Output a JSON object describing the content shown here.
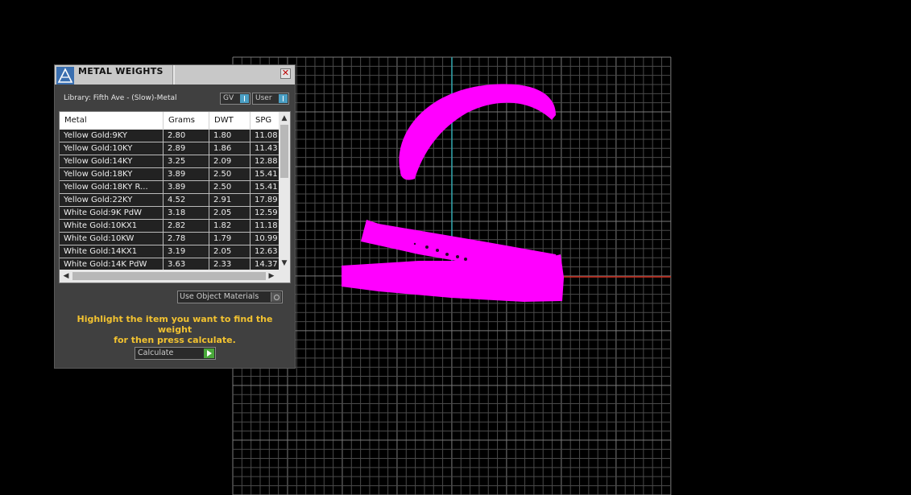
{
  "colors": {
    "grid": "#5c5c5c",
    "axis_x": "#cc2a1a",
    "axis_y": "#2fa6ad",
    "model": "#ff00ff",
    "accent": "#f2c230"
  },
  "panel": {
    "title": "METAL WEIGHTS",
    "close_symbol": "✕",
    "library_label": "Library: Fifth Ave - (Slow)-Metal",
    "toggle_gv": "GV",
    "toggle_user": "User",
    "table": {
      "columns": [
        "Metal",
        "Grams",
        "DWT",
        "SPG"
      ],
      "rows": [
        [
          "Yellow Gold:9KY",
          "2.80",
          "1.80",
          "11.08"
        ],
        [
          "Yellow Gold:10KY",
          "2.89",
          "1.86",
          "11.43"
        ],
        [
          "Yellow Gold:14KY",
          "3.25",
          "2.09",
          "12.88"
        ],
        [
          "Yellow Gold:18KY",
          "3.89",
          "2.50",
          "15.41"
        ],
        [
          "Yellow Gold:18KY R...",
          "3.89",
          "2.50",
          "15.41"
        ],
        [
          "Yellow Gold:22KY",
          "4.52",
          "2.91",
          "17.89"
        ],
        [
          "White Gold:9K PdW",
          "3.18",
          "2.05",
          "12.59"
        ],
        [
          "White Gold:10KX1",
          "2.82",
          "1.82",
          "11.18"
        ],
        [
          "White Gold:10KW",
          "2.78",
          "1.79",
          "10.99"
        ],
        [
          "White Gold:14KX1",
          "3.19",
          "2.05",
          "12.63"
        ],
        [
          "White Gold:14K PdW",
          "3.63",
          "2.33",
          "14.37"
        ]
      ]
    },
    "use_object_materials": "Use Object Materials",
    "hint_line1": "Highlight the item you want to find the weight",
    "hint_line2": "for then press calculate.",
    "calculate_label": "Calculate"
  }
}
